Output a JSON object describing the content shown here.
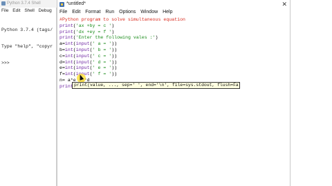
{
  "shell": {
    "title": "Python 3.7.4 Shell",
    "menu": [
      "File",
      "Edit",
      "Shell",
      "Debug"
    ],
    "lines": [
      "Python 3.7.4 (tags/",
      "Type \"help\", \"copyr",
      ">>>"
    ]
  },
  "editor": {
    "title": "*untitled*",
    "close_glyph": "✕",
    "menu": [
      "File",
      "Edit",
      "Format",
      "Run",
      "Options",
      "Window",
      "Help"
    ],
    "code": [
      [
        {
          "t": "comment",
          "v": "#Python program to solve simultaneous equation"
        }
      ],
      [
        {
          "t": "keyword",
          "v": "print"
        },
        {
          "t": "plain",
          "v": "("
        },
        {
          "t": "string",
          "v": "'ax +by = c '"
        },
        {
          "t": "plain",
          "v": ")"
        }
      ],
      [
        {
          "t": "keyword",
          "v": "print"
        },
        {
          "t": "plain",
          "v": "("
        },
        {
          "t": "string",
          "v": "'dx +ey = f '"
        },
        {
          "t": "plain",
          "v": ")"
        }
      ],
      [
        {
          "t": "keyword",
          "v": "print"
        },
        {
          "t": "plain",
          "v": "("
        },
        {
          "t": "string",
          "v": "'Enter the following vales :'"
        },
        {
          "t": "plain",
          "v": ")"
        }
      ],
      [
        {
          "t": "plain",
          "v": "a="
        },
        {
          "t": "keyword",
          "v": "int"
        },
        {
          "t": "plain",
          "v": "("
        },
        {
          "t": "keyword",
          "v": "input"
        },
        {
          "t": "plain",
          "v": "("
        },
        {
          "t": "string",
          "v": "' a = '"
        },
        {
          "t": "plain",
          "v": "))"
        }
      ],
      [
        {
          "t": "plain",
          "v": "b="
        },
        {
          "t": "keyword",
          "v": "int"
        },
        {
          "t": "plain",
          "v": "("
        },
        {
          "t": "keyword",
          "v": "input"
        },
        {
          "t": "plain",
          "v": "("
        },
        {
          "t": "string",
          "v": "' b = '"
        },
        {
          "t": "plain",
          "v": "))"
        }
      ],
      [
        {
          "t": "plain",
          "v": "c="
        },
        {
          "t": "keyword",
          "v": "int"
        },
        {
          "t": "plain",
          "v": "("
        },
        {
          "t": "keyword",
          "v": "input"
        },
        {
          "t": "plain",
          "v": "("
        },
        {
          "t": "string",
          "v": "' c = '"
        },
        {
          "t": "plain",
          "v": "))"
        }
      ],
      [
        {
          "t": "plain",
          "v": "d="
        },
        {
          "t": "keyword",
          "v": "int"
        },
        {
          "t": "plain",
          "v": "("
        },
        {
          "t": "keyword",
          "v": "input"
        },
        {
          "t": "plain",
          "v": "("
        },
        {
          "t": "string",
          "v": "' d = '"
        },
        {
          "t": "plain",
          "v": "))"
        }
      ],
      [
        {
          "t": "plain",
          "v": "e="
        },
        {
          "t": "keyword",
          "v": "int"
        },
        {
          "t": "plain",
          "v": "("
        },
        {
          "t": "keyword",
          "v": "input"
        },
        {
          "t": "plain",
          "v": "("
        },
        {
          "t": "string",
          "v": "' e = '"
        },
        {
          "t": "plain",
          "v": "))"
        }
      ],
      [
        {
          "t": "plain",
          "v": "f="
        },
        {
          "t": "keyword",
          "v": "int"
        },
        {
          "t": "plain",
          "v": "("
        },
        {
          "t": "keyword",
          "v": "input"
        },
        {
          "t": "plain",
          "v": "("
        },
        {
          "t": "string",
          "v": "' f = '"
        },
        {
          "t": "plain",
          "v": "))"
        }
      ],
      [
        {
          "t": "plain",
          "v": "n= a*e -b*d"
        }
      ],
      [
        {
          "t": "keyword",
          "v": "print"
        },
        {
          "t": "plain",
          "v": "("
        }
      ]
    ],
    "calltip": "print(value, ..., sep=' ', end='\\n', file=sys.stdout, flush=False)"
  },
  "colors": {
    "comment": "#d9281b",
    "keyword": "#6a1fa0",
    "string": "#178a17",
    "calltip_bg": "#ffffe1",
    "cursor_highlight": "#ffe13c"
  }
}
